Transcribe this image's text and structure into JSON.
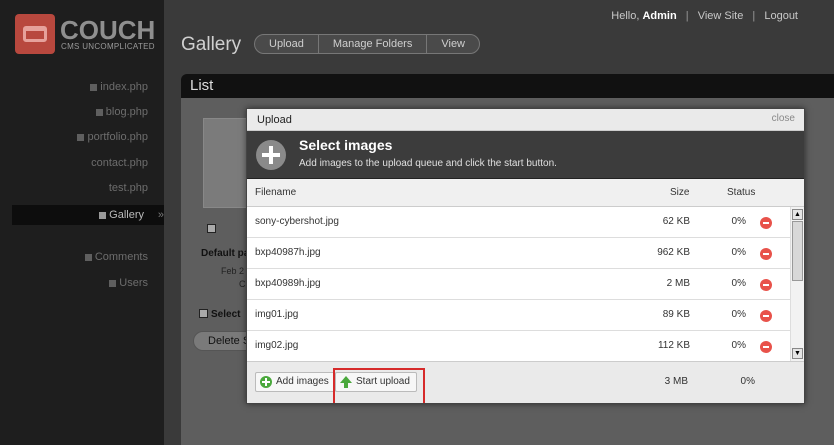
{
  "logo": {
    "title": "COUCH",
    "subtitle": "CMS UNCOMPLICATED"
  },
  "sidebar": {
    "items": [
      {
        "label": "index.php"
      },
      {
        "label": "blog.php"
      },
      {
        "label": "portfolio.php"
      },
      {
        "label": "contact.php"
      },
      {
        "label": "test.php"
      },
      {
        "label": "Gallery",
        "active": true
      },
      {
        "label": "Comments"
      },
      {
        "label": "Users"
      }
    ],
    "active_chevron": "»"
  },
  "topbar": {
    "greeting": "Hello,",
    "user": "Admin",
    "view_site": "View Site",
    "logout": "Logout",
    "separator": "|"
  },
  "page": {
    "title": "Gallery",
    "tabs": [
      "Upload",
      "Manage Folders",
      "View"
    ],
    "list_header": "List"
  },
  "background_list": {
    "item_name": "Default pa",
    "item_date": "Feb 2",
    "item_extra": "C",
    "select_all": "Select",
    "delete_button": "Delete S"
  },
  "modal": {
    "title": "Upload",
    "close_label": "close",
    "heading": "Select images",
    "instructions": "Add images to the upload queue and click the start button.",
    "columns": {
      "filename": "Filename",
      "size": "Size",
      "status": "Status"
    },
    "files": [
      {
        "name": "sony-cybershot.jpg",
        "size": "62 KB",
        "status": "0%"
      },
      {
        "name": "bxp40987h.jpg",
        "size": "962 KB",
        "status": "0%"
      },
      {
        "name": "bxp40989h.jpg",
        "size": "2 MB",
        "status": "0%"
      },
      {
        "name": "img01.jpg",
        "size": "89 KB",
        "status": "0%"
      },
      {
        "name": "img02.jpg",
        "size": "112 KB",
        "status": "0%"
      }
    ],
    "add_button": "Add images",
    "start_button": "Start upload",
    "total_size": "3 MB",
    "total_status": "0%"
  },
  "colors": {
    "highlight": "#d62a2a",
    "remove_icon": "#e8524a",
    "add_icon": "#4aa83c",
    "logo": "#b8483e"
  }
}
